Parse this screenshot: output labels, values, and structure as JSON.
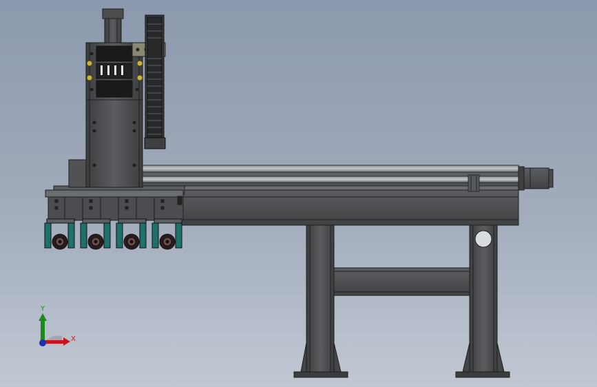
{
  "viewport": {
    "background_top": "#8c98ad",
    "background_bottom": "#c1c8d3"
  },
  "model": {
    "metal_color": "#4d4f51",
    "metal_dark": "#2b2c2e",
    "metal_light": "#7c7f82",
    "wheel_cover_color": "#1f6f6a"
  },
  "triad": {
    "x_label": "X",
    "y_label": "Y",
    "x_color": "#c8141e",
    "y_color": "#1a8a1a",
    "z_color": "#1b2fb0",
    "icon": "coordinate-triad-icon"
  }
}
